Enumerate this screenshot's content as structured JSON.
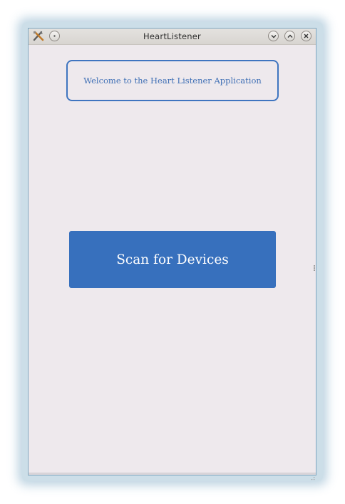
{
  "window": {
    "title": "HeartListener",
    "app_icon": "tools-icon",
    "controls": {
      "menu": "window-menu-icon",
      "minimize": "chevron-down-icon",
      "maximize": "chevron-up-icon",
      "close": "close-icon"
    }
  },
  "main": {
    "welcome_text": "Welcome to the Heart Listener Application",
    "scan_button_label": "Scan for Devices"
  },
  "colors": {
    "accent": "#3770bd",
    "accent_border": "#3f75c0",
    "background": "#eee9ed"
  }
}
